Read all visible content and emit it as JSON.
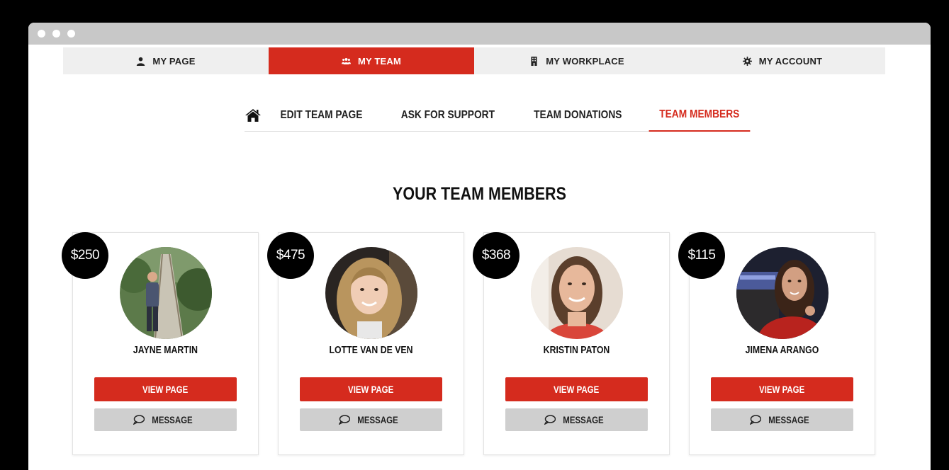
{
  "topnav": {
    "items": [
      {
        "label": "MY PAGE",
        "icon": "user-icon",
        "active": false
      },
      {
        "label": "MY TEAM",
        "icon": "team-icon",
        "active": true
      },
      {
        "label": "MY WORKPLACE",
        "icon": "building-icon",
        "active": false
      },
      {
        "label": "MY ACCOUNT",
        "icon": "gear-icon",
        "active": false
      }
    ]
  },
  "subnav": {
    "home_icon": "home-icon",
    "items": [
      {
        "label": "EDIT TEAM PAGE",
        "active": false
      },
      {
        "label": "ASK FOR SUPPORT",
        "active": false
      },
      {
        "label": "TEAM DONATIONS",
        "active": false
      },
      {
        "label": "TEAM MEMBERS",
        "active": true
      }
    ]
  },
  "section_title": "YOUR TEAM MEMBERS",
  "members": [
    {
      "amount": "$250",
      "name": "JAYNE MARTIN",
      "view_label": "VIEW PAGE",
      "message_label": "MESSAGE"
    },
    {
      "amount": "$475",
      "name": "LOTTE VAN DE VEN",
      "view_label": "VIEW PAGE",
      "message_label": "MESSAGE"
    },
    {
      "amount": "$368",
      "name": "KRISTIN PATON",
      "view_label": "VIEW PAGE",
      "message_label": "MESSAGE"
    },
    {
      "amount": "$115",
      "name": "JIMENA ARANGO",
      "view_label": "VIEW PAGE",
      "message_label": "MESSAGE"
    }
  ],
  "colors": {
    "accent": "#d52b1e",
    "nav_bg": "#efefef",
    "message_bg": "#cfcfcf"
  }
}
